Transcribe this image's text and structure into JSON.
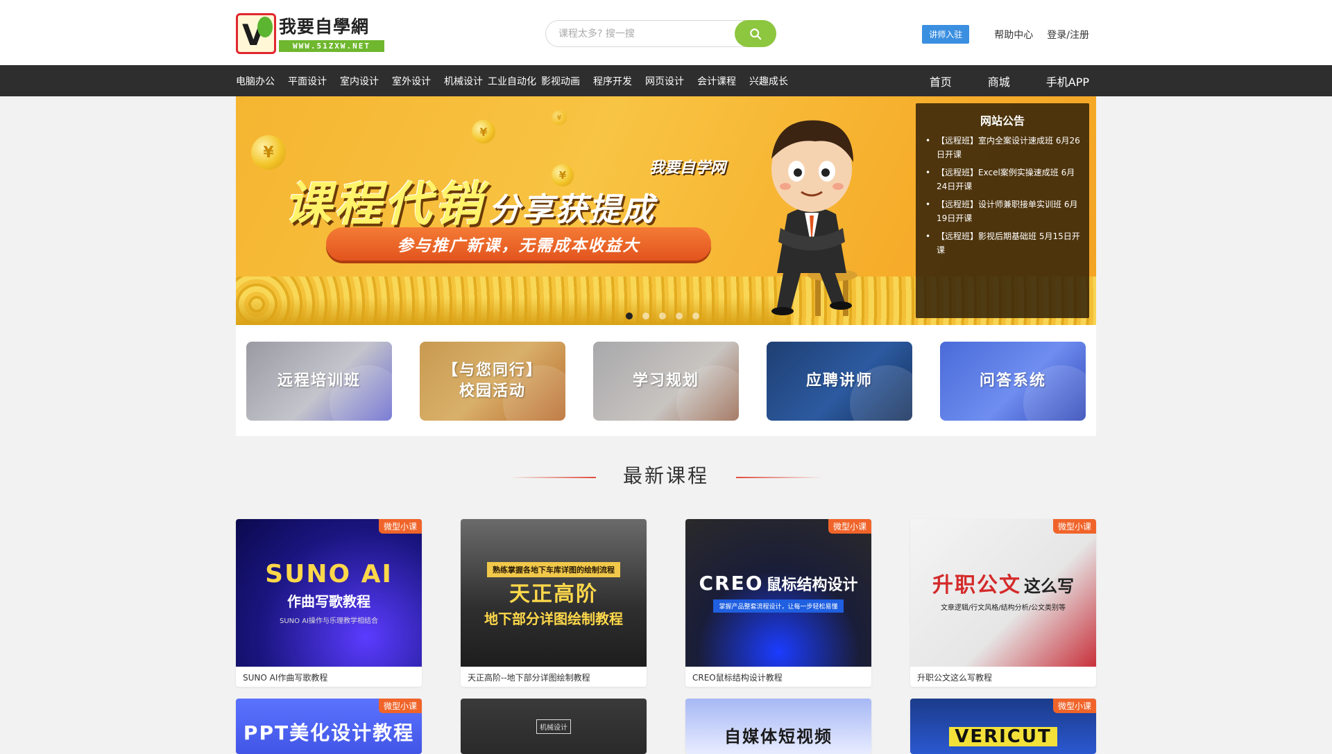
{
  "header": {
    "logo": {
      "brand": "我要自學網",
      "url": "WWW.51ZXW.NET"
    },
    "search": {
      "placeholder": "课程太多? 搜一搜"
    },
    "lecturer_btn": "讲师入驻",
    "help": "帮助中心",
    "login": "登录/注册"
  },
  "nav": {
    "categories": [
      "电脑办公",
      "平面设计",
      "室内设计",
      "室外设计",
      "机械设计",
      "工业自动化",
      "影视动画",
      "程序开发",
      "网页设计",
      "会计课程",
      "兴趣成长"
    ],
    "main": [
      "首页",
      "商城",
      "手机APP"
    ]
  },
  "banner": {
    "brand": "我要自学网",
    "title_main": "课程代销",
    "title_sub": "分享获提成",
    "pill": "参与推广新课，无需成本收益大",
    "coin_symbol": "¥",
    "slide_count": 5,
    "active_slide": 1
  },
  "notice": {
    "title": "网站公告",
    "items": [
      "【远程班】室内全案设计速成班 6月26日开课",
      "【远程班】Excel案例实操速成班 6月24日开课",
      "【远程班】设计师兼职接单实训班 6月19日开课",
      "【远程班】影视后期基础班 5月15日开课"
    ]
  },
  "features": [
    {
      "line1": "远程培训班",
      "line2": ""
    },
    {
      "line1": "【与您同行】",
      "line2": "校园活动"
    },
    {
      "line1": "学习规划",
      "line2": ""
    },
    {
      "line1": "应聘讲师",
      "line2": ""
    },
    {
      "line1": "问答系统",
      "line2": ""
    }
  ],
  "latest": {
    "title": "最新课程",
    "badge": "微型小课",
    "courses": [
      {
        "name": "SUNO AI作曲写歌教程",
        "img_big": "SUNO AI",
        "img_sub": "作曲写歌教程",
        "img_small": "SUNO AI操作与乐理教学相结合"
      },
      {
        "name": "天正高阶--地下部分详图绘制教程",
        "img_big": "天正高阶",
        "img_sub": "地下部分详图绘制教程",
        "img_small": "熟练掌握各地下车库详图的绘制流程"
      },
      {
        "name": "CREO鼠标结构设计教程",
        "img_big": "CREO",
        "img_sub": "鼠标结构设计",
        "img_small": "掌握产品整套流程设计，让每一步轻松易懂"
      },
      {
        "name": "升职公文这么写教程",
        "img_big": "升职公文",
        "img_sub": "这么写",
        "img_small": "文章逻辑/行文风格/结构分析/公文类别等"
      }
    ],
    "partial": [
      {
        "img_text": "PPT美化设计教程"
      },
      {
        "img_text": "机械设计"
      },
      {
        "img_text": "自媒体短视频"
      },
      {
        "img_text": "VERICUT"
      }
    ]
  }
}
